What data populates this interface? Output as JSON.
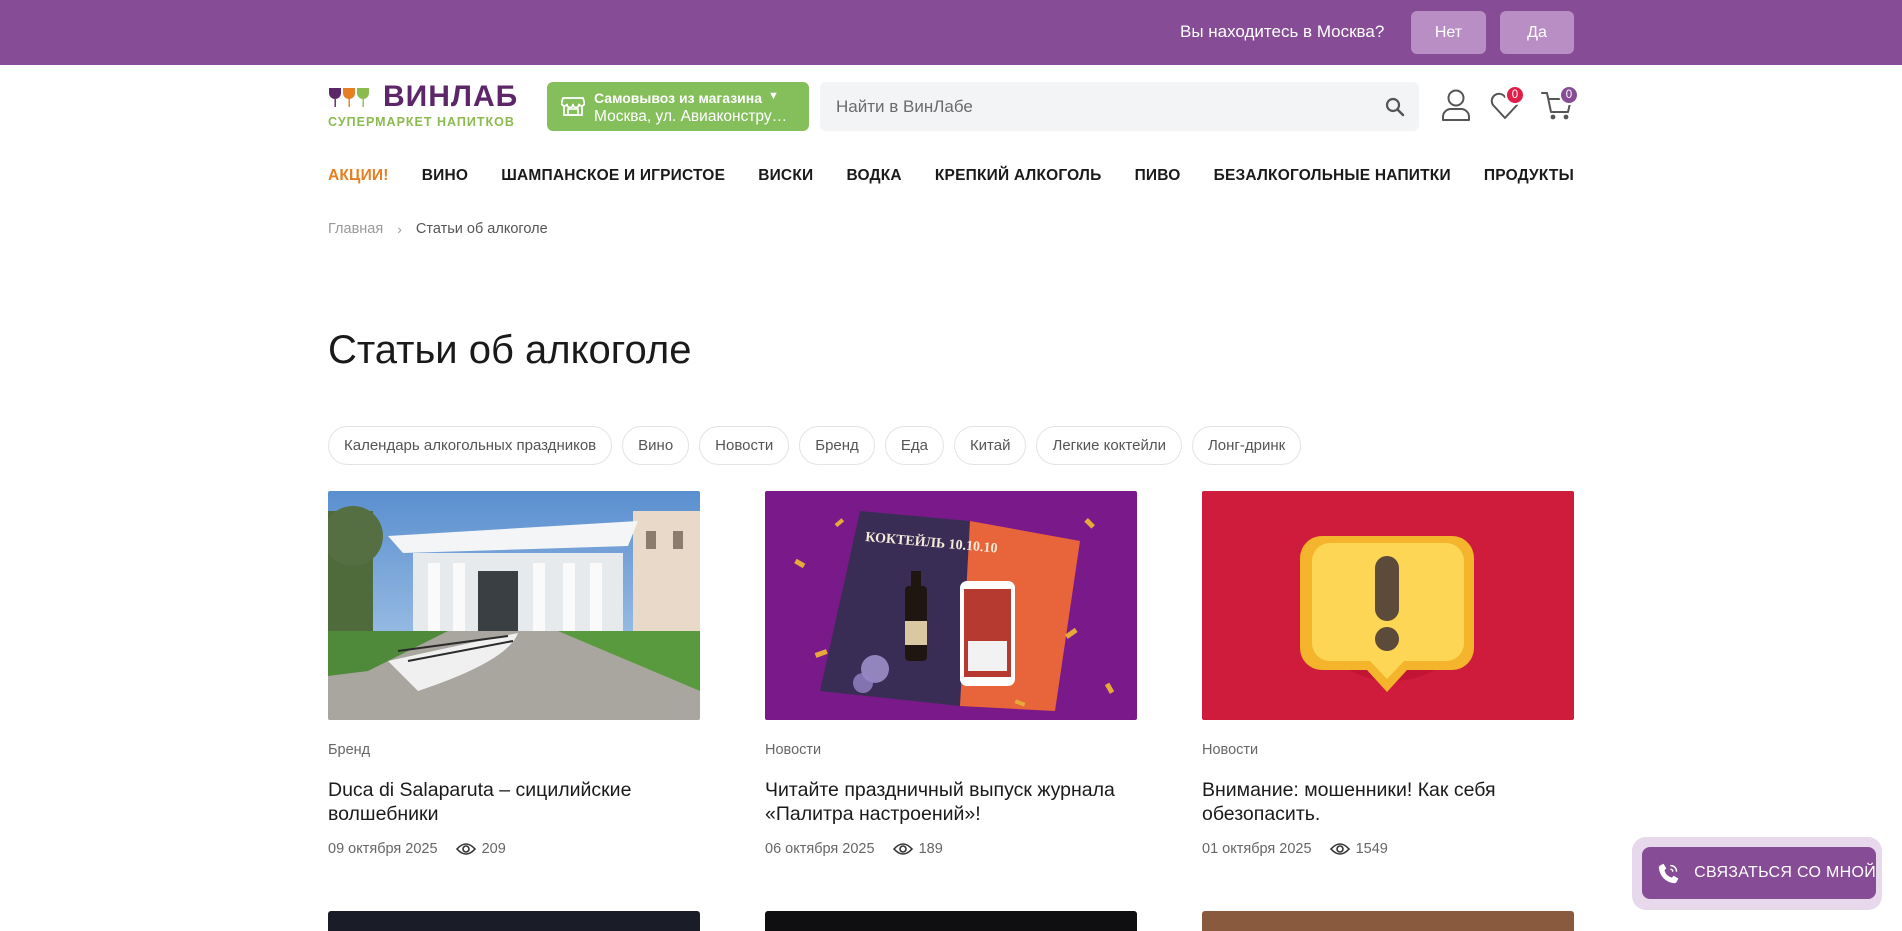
{
  "geo": {
    "question": "Вы находитесь в Москва?",
    "no_label": "Нет",
    "yes_label": "Да"
  },
  "logo": {
    "name": "ВИНЛАБ",
    "tagline": "СУПЕРМАРКЕТ НАПИТКОВ"
  },
  "pickup": {
    "title": "Самовывоз из магазина",
    "address": "Москва, ул. Авиаконструктора"
  },
  "search": {
    "placeholder": "Найти в ВинЛабе"
  },
  "badges": {
    "favorites": "0",
    "cart": "0"
  },
  "nav": {
    "items": [
      "АКЦИИ!",
      "ВИНО",
      "ШАМПАНСКОЕ И ИГРИСТОЕ",
      "ВИСКИ",
      "ВОДКА",
      "КРЕПКИЙ АЛКОГОЛЬ",
      "ПИВО",
      "БЕЗАЛКОГОЛЬНЫЕ НАПИТКИ",
      "ПРОДУКТЫ"
    ]
  },
  "breadcrumb": {
    "home": "Главная",
    "separator": "›",
    "current": "Статьи об алкоголе"
  },
  "page": {
    "title": "Статьи об алкоголе"
  },
  "chips": [
    "Календарь алкогольных праздников",
    "Вино",
    "Новости",
    "Бренд",
    "Еда",
    "Китай",
    "Легкие коктейли",
    "Лонг-дринк"
  ],
  "articles": [
    {
      "tag": "Бренд",
      "title": "Duca di Salaparuta – сицилийские волшебники",
      "date": "09 октября 2025",
      "views": "209"
    },
    {
      "tag": "Новости",
      "title": "Читайте праздничный выпуск журнала «Палитра настроений»!",
      "date": "06 октября 2025",
      "views": "189"
    },
    {
      "tag": "Новости",
      "title": "Внимание: мошенники! Как себя обезопасить.",
      "date": "01 октября 2025",
      "views": "1549"
    }
  ],
  "magazine_cover": {
    "headline": "КОКТЕЙЛЬ 10.10.10"
  },
  "contact": {
    "label": "СВЯЗАТЬСЯ СО МНОЙ"
  },
  "colors": {
    "brand_purple": "#874c96",
    "brand_green": "#85bf5c",
    "promo_orange": "#e67e22",
    "badge_red": "#e11d48"
  }
}
